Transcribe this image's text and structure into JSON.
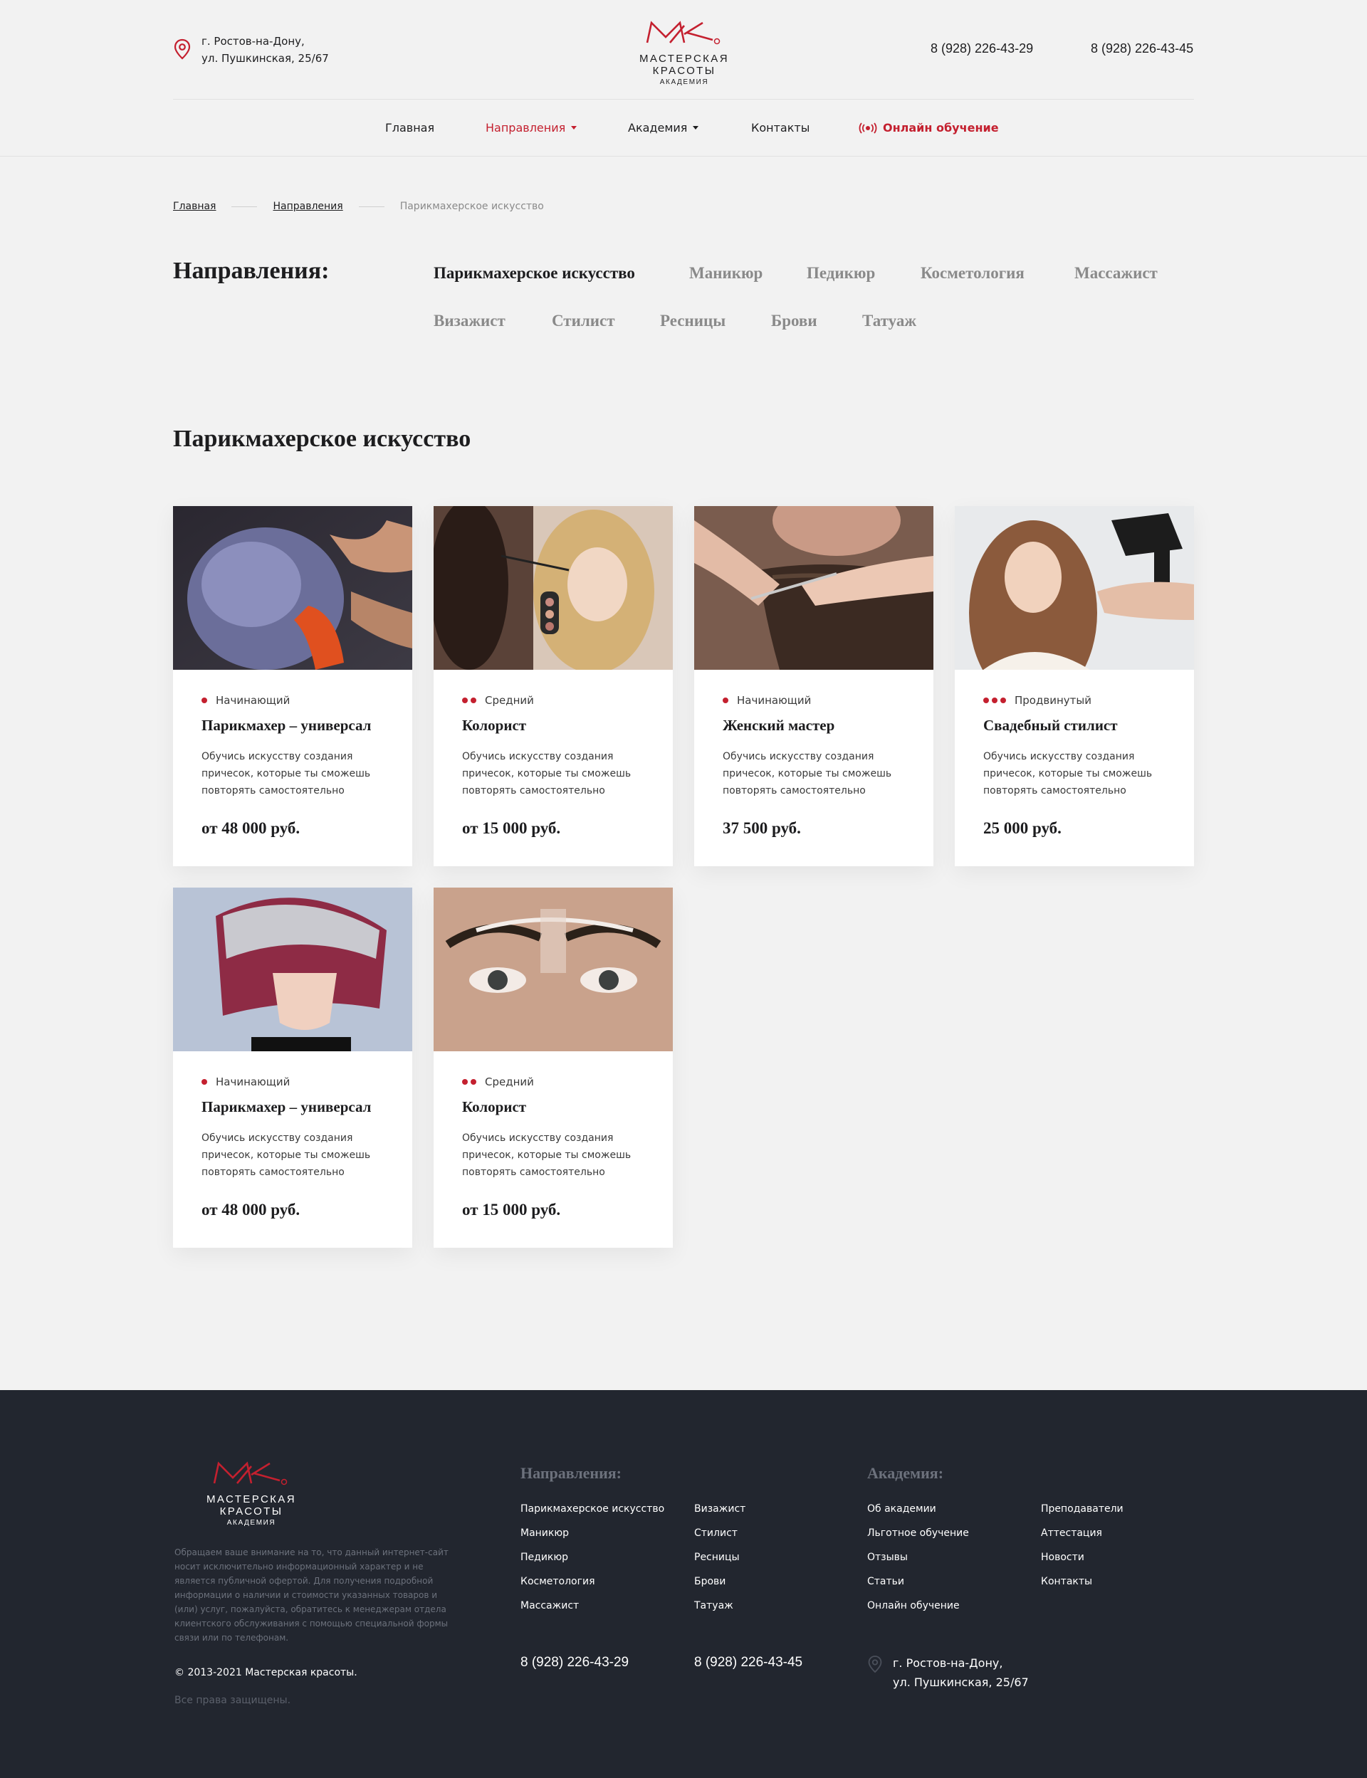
{
  "header": {
    "address_line1": "г. Ростов-на-Дону,",
    "address_line2": "ул. Пушкинская, 25/67",
    "logo_name": "МАСТЕРСКАЯ КРАСОТЫ",
    "logo_sub": "АКАДЕМИЯ",
    "phone1": "8 (928) 226-43-29",
    "phone2": "8 (928) 226-43-45"
  },
  "nav": {
    "home": "Главная",
    "directions": "Направления",
    "academy": "Академия",
    "contacts": "Контакты",
    "online": "Онлайн обучение"
  },
  "breadcrumb": {
    "home": "Главная",
    "directions": "Направления",
    "current": "Парикмахерское искусство"
  },
  "directions": {
    "title": "Направления:",
    "items": [
      "Парикмахерское искусство",
      "Маникюр",
      "Педикюр",
      "Косметология",
      "Массажист",
      "Визажист",
      "Стилист",
      "Ресницы",
      "Брови",
      "Татуаж"
    ],
    "active": "Парикмахерское искусство"
  },
  "section_title": "Парикмахерское искусство",
  "cards": [
    {
      "level": "Начинающий",
      "level_dots": 1,
      "title": "Парикмахер – универсал",
      "desc": "Обучись искусству создания причесок, которые ты сможешь повторять самостоятельно",
      "price": "от 48 000 руб."
    },
    {
      "level": "Средний",
      "level_dots": 2,
      "title": "Колорист",
      "desc": "Обучись искусству создания причесок, которые ты сможешь повторять самостоятельно",
      "price": "от 15 000 руб."
    },
    {
      "level": "Начинающий",
      "level_dots": 1,
      "title": "Женский мастер",
      "desc": "Обучись искусству создания причесок, которые ты сможешь повторять самостоятельно",
      "price": "37 500 руб."
    },
    {
      "level": "Продвинутый",
      "level_dots": 3,
      "title": "Свадебный стилист",
      "desc": "Обучись искусству создания причесок, которые ты сможешь повторять самостоятельно",
      "price": "25 000 руб."
    },
    {
      "level": "Начинающий",
      "level_dots": 1,
      "title": "Парикмахер – универсал",
      "desc": "Обучись искусству создания причесок, которые ты сможешь повторять самостоятельно",
      "price": "от 48 000 руб."
    },
    {
      "level": "Средний",
      "level_dots": 2,
      "title": "Колорист",
      "desc": "Обучись искусству создания причесок, которые ты сможешь повторять самостоятельно",
      "price": "от 15 000 руб."
    }
  ],
  "footer": {
    "logo_name": "МАСТЕРСКАЯ КРАСОТЫ",
    "logo_sub": "АКАДЕМИЯ",
    "note": "Обращаем ваше внимание на то, что данный интернет-сайт носит исключительно информационный характер и не является публичной офертой. Для получения подробной информации о наличии и стоимости указанных товаров и (или) услуг, пожалуйста, обратитесь к менеджерам отдела клиентского обслуживания с помощью специальной формы связи или по телефонам.",
    "copyright": "© 2013-2021 Мастерская красоты.",
    "rights": "Все права защищены.",
    "directions_title": "Направления:",
    "directions_col1": [
      "Парикмахерское искусство",
      "Маникюр",
      "Педикюр",
      "Косметология",
      "Массажист"
    ],
    "directions_col2": [
      "Визажист",
      "Стилист",
      "Ресницы",
      "Брови",
      "Татуаж"
    ],
    "academy_title": "Академия:",
    "academy_col1": [
      "Об академии",
      "Льготное обучение",
      "Отзывы",
      "Статьи",
      "Онлайн обучение"
    ],
    "academy_col2": [
      "Преподаватели",
      "Аттестация",
      "Новости",
      "Контакты"
    ],
    "phone1": "8 (928) 226-43-29",
    "phone2": "8 (928) 226-43-45",
    "address_line1": "г. Ростов-на-Дону,",
    "address_line2": "ул. Пушкинская, 25/67"
  },
  "colors": {
    "accent": "#c4202f",
    "background": "#f2f2f2",
    "footer": "#22262f"
  }
}
